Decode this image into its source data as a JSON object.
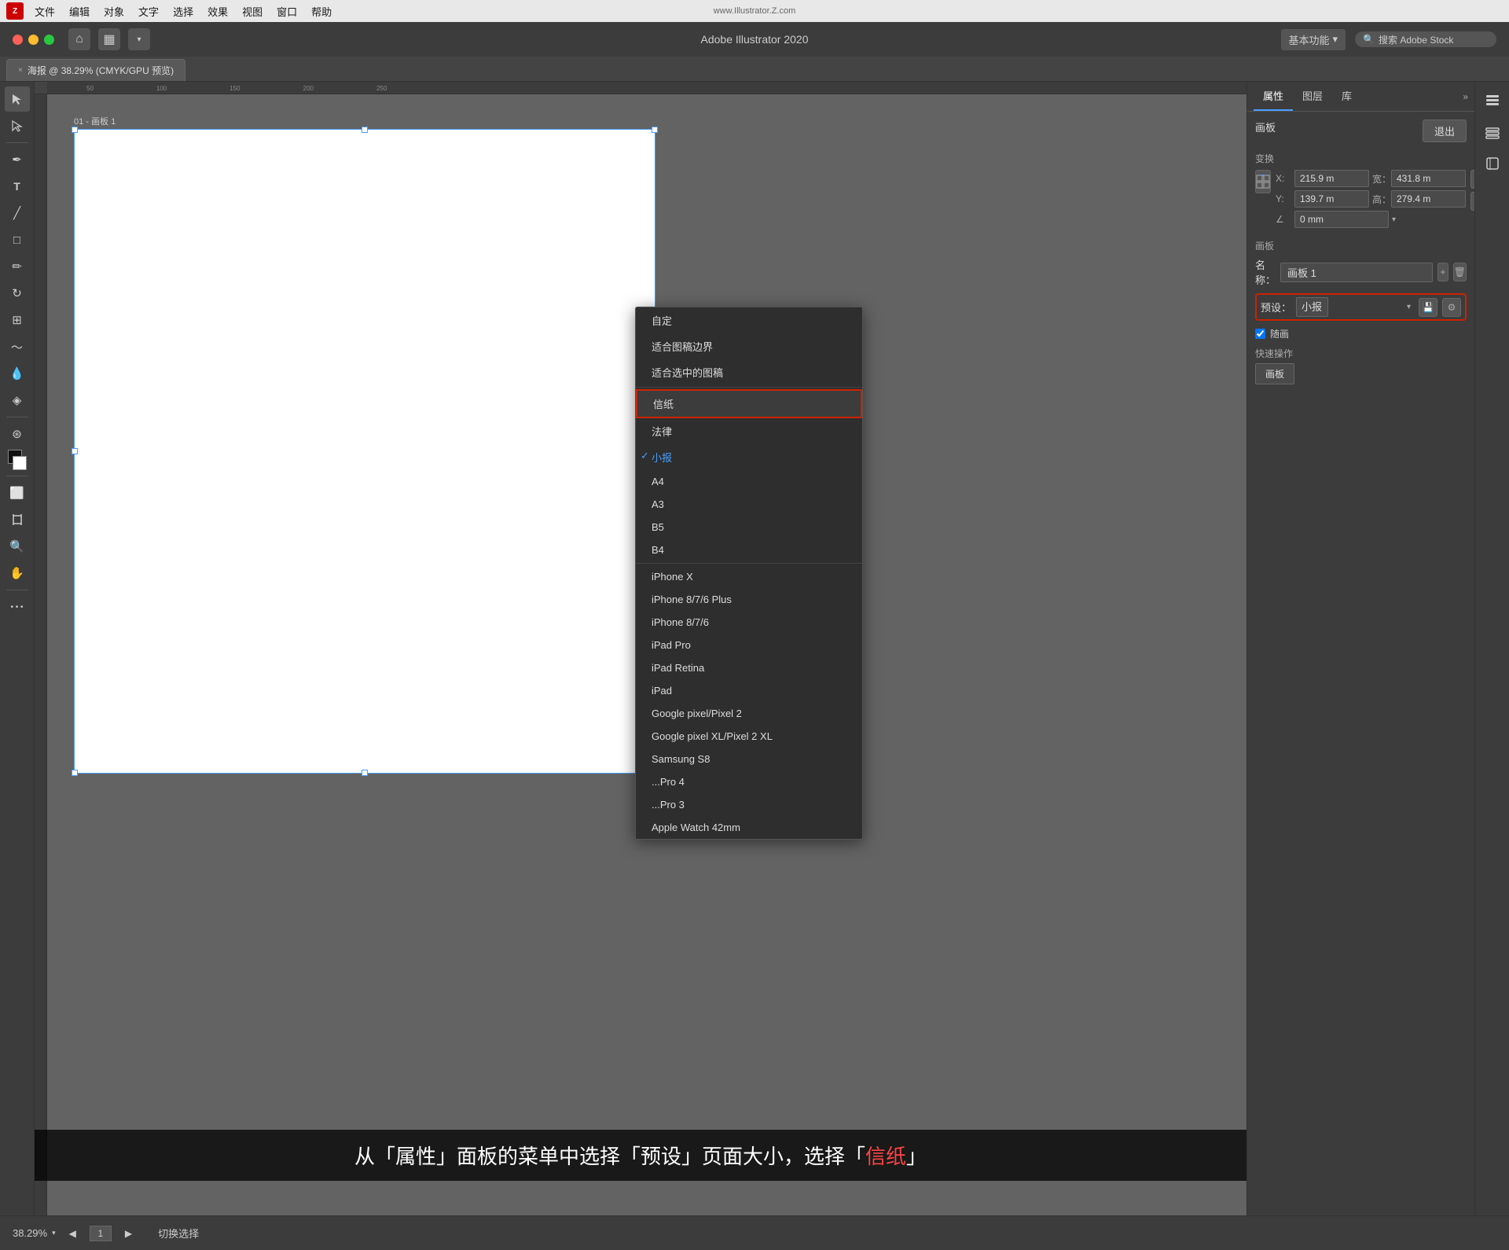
{
  "app": {
    "title": "Adobe Illustrator 2020",
    "watermark": "www.Illustrator.Z.com"
  },
  "menubar": {
    "items": [
      "Z",
      "文件",
      "编辑",
      "对象",
      "文字",
      "选择",
      "效果",
      "视图",
      "窗口",
      "帮助"
    ]
  },
  "tabs": {
    "close_label": "×",
    "doc_tab": "海报 @ 38.29% (CMYK/GPU 预览)"
  },
  "toolbar": {
    "workspace_label": "基本功能",
    "search_placeholder": "搜索 Adobe Stock"
  },
  "right_panel": {
    "tabs": [
      "属性",
      "图层",
      "库"
    ],
    "expand_label": "»",
    "artboard_section": "画板",
    "exit_btn": "退出",
    "transform_section": "变换",
    "x_label": "X:",
    "x_value": "215.9 m",
    "y_label": "Y:",
    "y_value": "139.7 m",
    "width_label": "宽：",
    "width_value": "431.8 m",
    "height_label": "高：",
    "height_value": "279.4 m",
    "angle_label": "∠",
    "angle_value": "0 mm",
    "artboard_panel_title": "画板",
    "name_label": "名称：",
    "name_value": "画板 1",
    "preset_label": "预设：",
    "preset_value": "小报",
    "checkbox_label": "随画",
    "quick_action_label": "快速操作",
    "quick_action_btn": "画板"
  },
  "dropdown": {
    "items": [
      {
        "label": "自定",
        "checked": false,
        "highlighted": false
      },
      {
        "label": "适合图稿边界",
        "checked": false,
        "highlighted": false
      },
      {
        "label": "适合选中的图稿",
        "checked": false,
        "highlighted": false
      },
      {
        "label": "信纸",
        "checked": false,
        "highlighted": true
      },
      {
        "label": "法律",
        "checked": false,
        "highlighted": false
      },
      {
        "label": "小报",
        "checked": true,
        "highlighted": false
      },
      {
        "label": "A4",
        "checked": false,
        "highlighted": false
      },
      {
        "label": "A3",
        "checked": false,
        "highlighted": false
      },
      {
        "label": "B5",
        "checked": false,
        "highlighted": false
      },
      {
        "label": "B4",
        "checked": false,
        "highlighted": false
      },
      {
        "label": "iPhone X",
        "checked": false,
        "highlighted": false
      },
      {
        "label": "iPhone 8/7/6 Plus",
        "checked": false,
        "highlighted": false
      },
      {
        "label": "iPhone 8/7/6",
        "checked": false,
        "highlighted": false
      },
      {
        "label": "iPad Pro",
        "checked": false,
        "highlighted": false
      },
      {
        "label": "iPad Retina",
        "checked": false,
        "highlighted": false
      },
      {
        "label": "iPad",
        "checked": false,
        "highlighted": false
      },
      {
        "label": "Google pixel/Pixel 2",
        "checked": false,
        "highlighted": false
      },
      {
        "label": "Google pixel XL/Pixel 2 XL",
        "checked": false,
        "highlighted": false
      },
      {
        "label": "Samsung S8",
        "checked": false,
        "highlighted": false
      },
      {
        "label": "...Pro 4",
        "checked": false,
        "highlighted": false
      },
      {
        "label": "...Pro 3",
        "checked": false,
        "highlighted": false
      },
      {
        "label": "Apple Watch 42mm",
        "checked": false,
        "highlighted": false
      }
    ]
  },
  "artboard": {
    "label": "01 - 画板 1",
    "zoom": "38.29%",
    "page_number": "1"
  },
  "status_bar": {
    "zoom": "38.29%",
    "page": "1",
    "status": "切换选择"
  },
  "annotation": {
    "text_parts": [
      "从「属性」面板的菜单中选择「预设」页面大小，选择「信纸」"
    ],
    "highlight_words": [
      "信纸"
    ]
  }
}
